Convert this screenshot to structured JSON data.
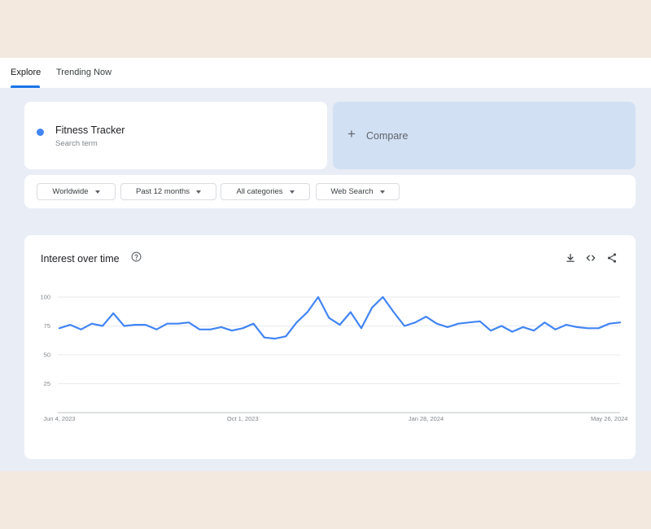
{
  "tabs": [
    {
      "label": "Explore",
      "active": true
    },
    {
      "label": "Trending Now",
      "active": false
    }
  ],
  "search_term": {
    "name": "Fitness Tracker",
    "subtitle": "Search term",
    "color": "#4285f4"
  },
  "compare": {
    "icon": "plus-icon",
    "label": "Compare"
  },
  "filters": [
    {
      "label": "Worldwide"
    },
    {
      "label": "Past 12 months"
    },
    {
      "label": "All categories"
    },
    {
      "label": "Web Search"
    }
  ],
  "chart_panel": {
    "title": "Interest over time",
    "icons": [
      "help-icon",
      "download-icon",
      "embed-code-icon",
      "share-icon"
    ]
  },
  "chart_data": {
    "type": "line",
    "title": "",
    "xlabel": "",
    "ylabel": "",
    "ylim": [
      0,
      100
    ],
    "y_ticks": [
      25,
      50,
      75,
      100
    ],
    "x_tick_labels": [
      "Jun 4, 2023",
      "Oct 1, 2023",
      "Jan 28, 2024",
      "May 26, 2024"
    ],
    "grid": true,
    "legend": "none",
    "series": [
      {
        "color": "#4285f4",
        "x": [
          "2023-06-04",
          "2023-06-11",
          "2023-06-18",
          "2023-06-25",
          "2023-07-02",
          "2023-07-09",
          "2023-07-16",
          "2023-07-23",
          "2023-07-30",
          "2023-08-06",
          "2023-08-13",
          "2023-08-20",
          "2023-08-27",
          "2023-09-03",
          "2023-09-10",
          "2023-09-17",
          "2023-09-24",
          "2023-10-01",
          "2023-10-08",
          "2023-10-15",
          "2023-10-22",
          "2023-10-29",
          "2023-11-05",
          "2023-11-12",
          "2023-11-19",
          "2023-11-26",
          "2023-12-03",
          "2023-12-10",
          "2023-12-17",
          "2023-12-24",
          "2023-12-31",
          "2024-01-07",
          "2024-01-14",
          "2024-01-21",
          "2024-01-28",
          "2024-02-04",
          "2024-02-11",
          "2024-02-18",
          "2024-02-25",
          "2024-03-03",
          "2024-03-10",
          "2024-03-17",
          "2024-03-24",
          "2024-03-31",
          "2024-04-07",
          "2024-04-14",
          "2024-04-21",
          "2024-04-28",
          "2024-05-05",
          "2024-05-12",
          "2024-05-19",
          "2024-05-26",
          "2024-06-02"
        ],
        "values": [
          73,
          76,
          72,
          77,
          75,
          86,
          75,
          76,
          76,
          72,
          77,
          77,
          78,
          72,
          72,
          74,
          71,
          73,
          77,
          65,
          64,
          66,
          78,
          87,
          100,
          82,
          76,
          87,
          73,
          91,
          100,
          87,
          75,
          78,
          83,
          77,
          74,
          77,
          78,
          79,
          71,
          75,
          70,
          74,
          71,
          78,
          72,
          76,
          74,
          73,
          73,
          77,
          78
        ]
      }
    ]
  }
}
